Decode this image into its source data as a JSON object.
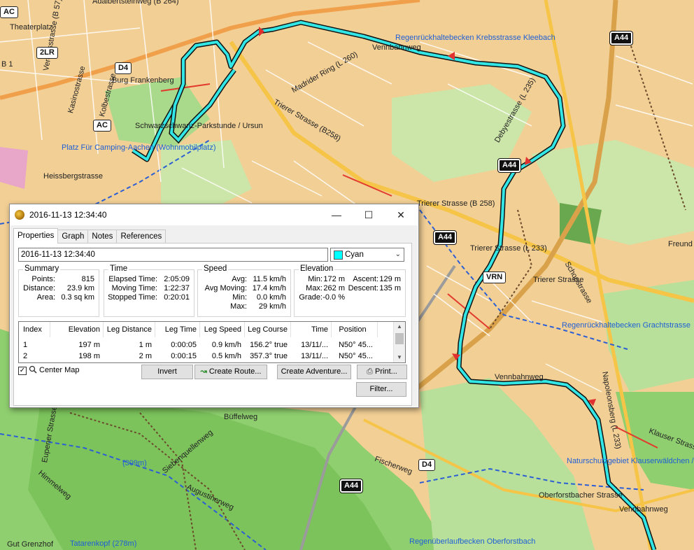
{
  "map": {
    "labels": {
      "adalbertsteinweg": "Adalbertsteinweg (B 264)",
      "theaterplatz": "Theaterplatz",
      "b1": "B 1",
      "vereinsstrasse": "Vereinsstrasse (B 57)",
      "kasinostrasse": "Kasinostrasse",
      "kolbestrasse": "Kolbestrasse",
      "burg_frankenberg": "Burg Frankenberg",
      "schwarzschwanz": "Schwarzschwanz-Parkstunde / Ursun",
      "platz_camping": "Platz Für Camping-Aachen (Wohnmobilplatz)",
      "heissbergstrasse": "Heissbergstrasse",
      "regenrueckhalt_kleebach": "Regenrückhaltebecken Krebsstrasse Kleebach",
      "vennbahnweg1": "Vennbahnweg",
      "madrider_ring": "Madrider Ring (L 260)",
      "trierer_b258": "Trierer Strasse (B258)",
      "debyestrasse": "Debyestrasse (L 235)",
      "trierer_b258b": "Trierer Strasse (B 258)",
      "trierer_l233": "Trierer Strasse (L 233)",
      "trierer_strasse": "Trierer Strasse",
      "schopstrasse": "Schopstrasse",
      "freund": "Freund",
      "regenrueckhalt_grachtstr": "Regenrückhaltebecken Grachtstrasse",
      "vennbahnweg2": "Vennbahnweg",
      "napoleonsberg": "Napoleonsberg (L 233)",
      "buffelweg": "Büffelweg",
      "fischerweg": "Fischerweg",
      "himmelweg": "Himmelweg",
      "eupener_strasse": "Eupener Strasse",
      "naturschutz": "Naturschutzgebiet Klauserwäldchen / Freund",
      "oberforstbacher": "Oberforstbacher Strasse",
      "vennbahnweg3": "Vennbahnweg",
      "regenrueckhalt_oberforstbach": "Regenüberlaufbecken Oberforstbach",
      "tatarenkopf": "Tatarenkopf (278m)",
      "peak309": "(309m)",
      "gutgrenzhof": "Gut Grenzhof",
      "augustinerweg": "Augustinerweg",
      "siebenquellenweg": "Siebenquellenweg",
      "klauser_strasse": "Klauser Strasse"
    },
    "shields": {
      "ac1": "AC",
      "ac2": "AC",
      "lr2": "2LR",
      "d4a": "D4",
      "d4b": "D4",
      "a44a": "A44",
      "a44b": "A44",
      "a44c": "A44",
      "a44d": "A44",
      "vrn": "VRN"
    }
  },
  "dialog": {
    "title": "2016-11-13 12:34:40",
    "minimize_glyph": "—",
    "maximize_glyph": "☐",
    "close_glyph": "✕",
    "tabs": [
      "Properties",
      "Graph",
      "Notes",
      "References"
    ],
    "name_value": "2016-11-13 12:34:40",
    "color": {
      "name": "Cyan",
      "hex": "#00ffff"
    },
    "summary": {
      "title": "Summary",
      "points_label": "Points:",
      "points": "815",
      "distance_label": "Distance:",
      "distance": "23.9 km",
      "area_label": "Area:",
      "area": "0.3 sq km"
    },
    "time": {
      "title": "Time",
      "elapsed_label": "Elapsed Time:",
      "elapsed": "2:05:09",
      "moving_label": "Moving Time:",
      "moving": "1:22:37",
      "stopped_label": "Stopped Time:",
      "stopped": "0:20:01"
    },
    "speed": {
      "title": "Speed",
      "avg_label": "Avg:",
      "avg": "11.5 km/h",
      "avg_moving_label": "Avg Moving:",
      "avg_moving": "17.4 km/h",
      "min_label": "Min:",
      "min": "0.0 km/h",
      "max_label": "Max:",
      "max": "29 km/h"
    },
    "elevation": {
      "title": "Elevation",
      "min_label": "Min:",
      "min": "172 m",
      "max_label": "Max:",
      "max": "262 m",
      "grade_label": "Grade:",
      "grade": "-0.0 %",
      "ascent_label": "Ascent:",
      "ascent": "129 m",
      "descent_label": "Descent:",
      "descent": "135 m"
    },
    "table": {
      "columns": [
        "Index",
        "Elevation",
        "Leg Distance",
        "Leg Time",
        "Leg Speed",
        "Leg Course",
        "Time",
        "Position"
      ],
      "rows": [
        [
          "1",
          "197 m",
          "1 m",
          "0:00:05",
          "0.9 km/h",
          "156.2° true",
          "13/11/...",
          "N50° 45..."
        ],
        [
          "2",
          "198 m",
          "2 m",
          "0:00:15",
          "0.5 km/h",
          "357.3° true",
          "13/11/...",
          "N50° 45..."
        ]
      ]
    },
    "center_map_label": "Center Map",
    "center_map_checked": "✓",
    "buttons": {
      "invert": "Invert",
      "create_route": "Create Route...",
      "create_adventure": "Create Adventure...",
      "print": "Print...",
      "filter": "Filter..."
    }
  }
}
